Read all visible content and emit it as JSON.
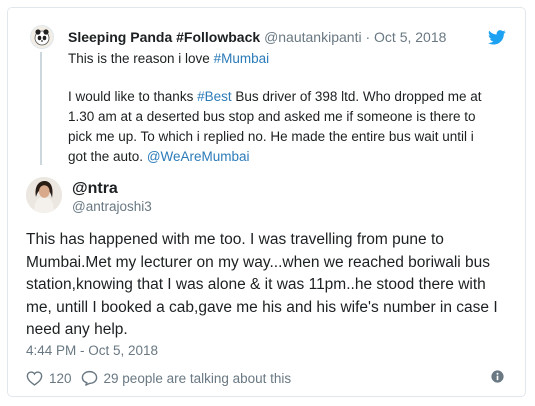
{
  "parent_tweet": {
    "display_name": "Sleeping Panda #Followback",
    "handle": "@nautankipanti",
    "separator": "·",
    "date": "Oct 5, 2018",
    "line1_text": "This is the reason i love ",
    "line1_hashtag": "#Mumbai",
    "quote_part1": "I would like to thanks ",
    "quote_hashtag": "#Best",
    "quote_part2": " Bus driver of 398 ltd. Who dropped me at 1.30 am at a deserted bus stop and asked me if someone is there to pick me up. To which i replied no. He made the entire bus wait until i got the auto. ",
    "quote_mention": "@WeAreMumbai"
  },
  "main_tweet": {
    "display_name": "@ntra",
    "handle": "@antrajoshi3",
    "text": "This has happened with me too.  I was travelling from pune to Mumbai.Met my lecturer on my way...when we reached boriwali bus station,knowing that I was alone & it was 11pm..he stood there with me, untill I booked a cab,gave me his and his wife's number in case I need any help.",
    "timestamp": "4:44 PM - Oct 5, 2018",
    "like_count": "120",
    "conversation_text": "29 people are talking about this"
  },
  "icons": {
    "brand": "twitter-bird-icon",
    "like": "heart-icon",
    "reply": "speech-bubble-icon",
    "info": "info-icon"
  },
  "colors": {
    "twitter_blue": "#1da1f2",
    "link": "#2b7bb9",
    "muted_text": "#697882",
    "border": "#e1e8ed"
  }
}
